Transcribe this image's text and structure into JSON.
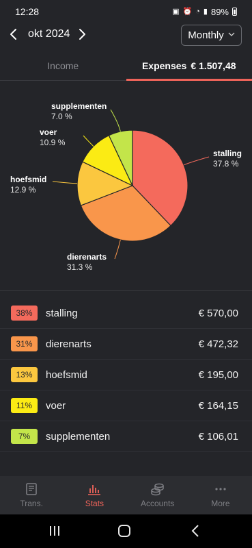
{
  "status_bar": {
    "time": "12:28",
    "battery": "89%"
  },
  "header": {
    "prev_icon": "chevron-left-icon",
    "month": "okt 2024",
    "next_icon": "chevron-right-icon",
    "period": "Monthly"
  },
  "tabs": [
    {
      "label": "Income",
      "amount": ""
    },
    {
      "label": "Expenses",
      "amount": "€ 1.507,48"
    }
  ],
  "chart_data": {
    "type": "pie",
    "slices": [
      {
        "label": "stalling",
        "value": 37.8,
        "pct_label": "37.8 %",
        "color": "#f46a5c"
      },
      {
        "label": "dierenarts",
        "value": 31.3,
        "pct_label": "31.3 %",
        "color": "#f9964b"
      },
      {
        "label": "hoefsmid",
        "value": 12.9,
        "pct_label": "12.9 %",
        "color": "#fbc73f"
      },
      {
        "label": "voer",
        "value": 10.9,
        "pct_label": "10.9 %",
        "color": "#fbeb14"
      },
      {
        "label": "supplementen",
        "value": 7.0,
        "pct_label": "7.0 %",
        "color": "#c3e54a"
      }
    ]
  },
  "categories": [
    {
      "pct": "38%",
      "name": "stalling",
      "amount": "€ 570,00",
      "color": "#f46a5c"
    },
    {
      "pct": "31%",
      "name": "dierenarts",
      "amount": "€ 472,32",
      "color": "#f9964b"
    },
    {
      "pct": "13%",
      "name": "hoefsmid",
      "amount": "€ 195,00",
      "color": "#fbc73f"
    },
    {
      "pct": "11%",
      "name": "voer",
      "amount": "€ 164,15",
      "color": "#fbeb14"
    },
    {
      "pct": "7%",
      "name": "supplementen",
      "amount": "€ 106,01",
      "color": "#c3e54a"
    }
  ],
  "bottom_nav": [
    {
      "label": "Trans.",
      "icon": "book-icon"
    },
    {
      "label": "Stats",
      "icon": "bar-chart-icon"
    },
    {
      "label": "Accounts",
      "icon": "coins-icon"
    },
    {
      "label": "More",
      "icon": "more-dots-icon"
    }
  ],
  "colors": {
    "accent": "#f0645a",
    "background": "#242529"
  }
}
